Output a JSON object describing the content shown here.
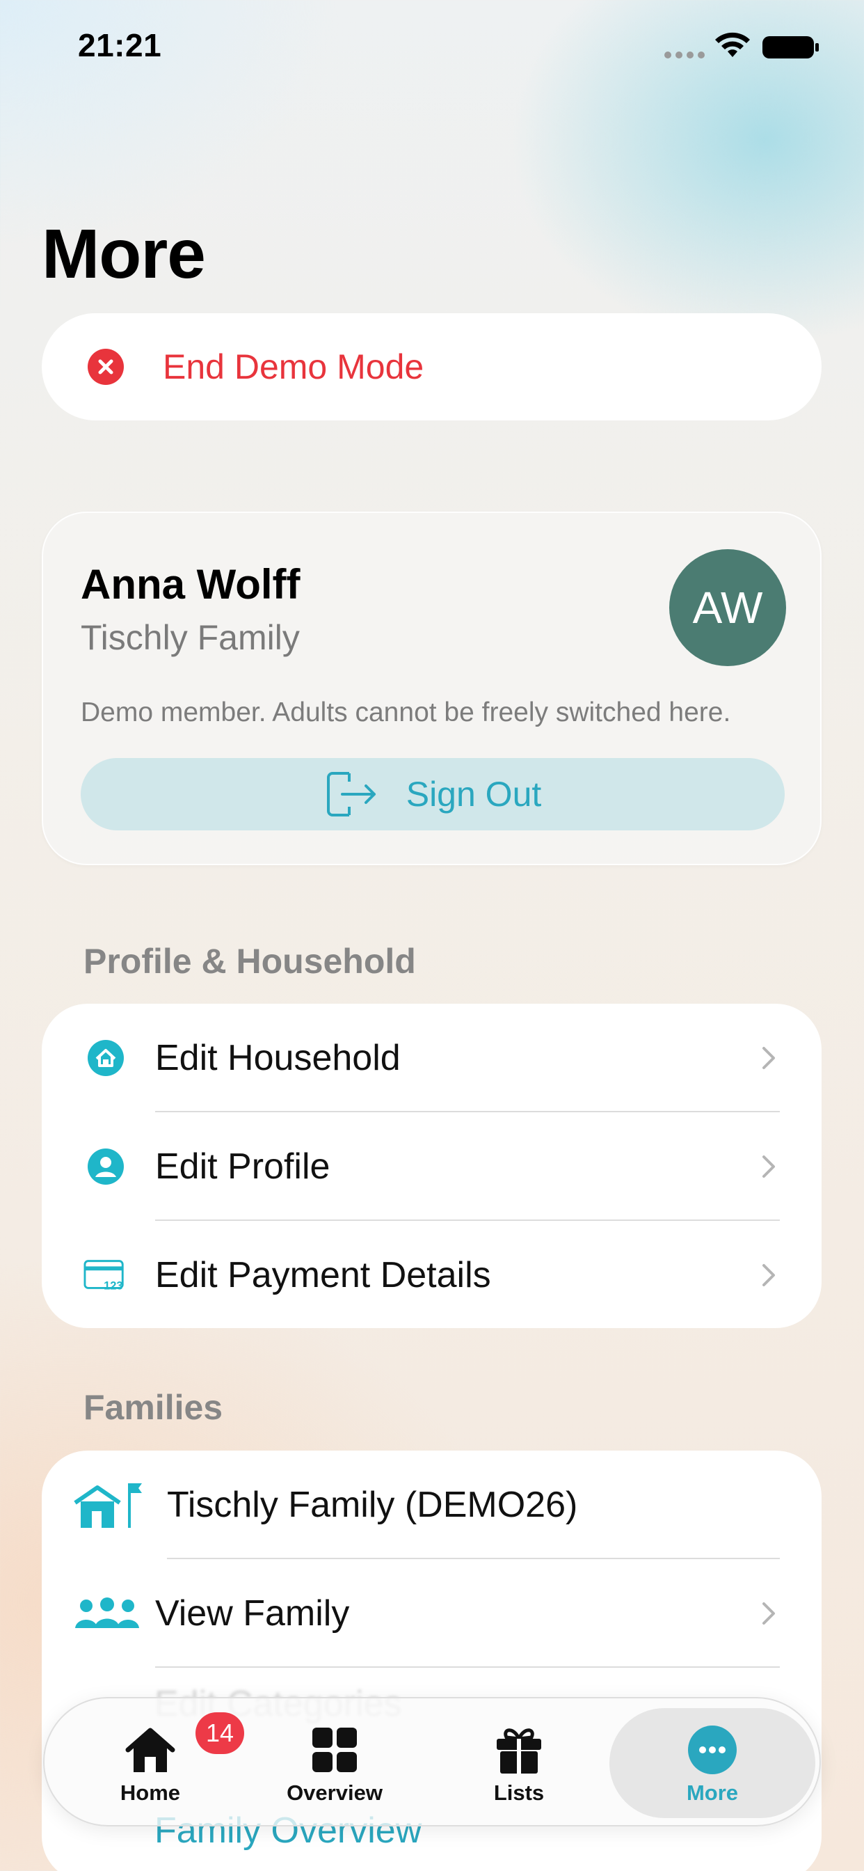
{
  "status_bar": {
    "time": "21:21"
  },
  "title": "More",
  "demo": {
    "label": "End Demo Mode"
  },
  "profile": {
    "name": "Anna Wolff",
    "family": "Tischly Family",
    "initials": "AW",
    "note": "Demo member. Adults cannot be freely switched here.",
    "sign_out_label": "Sign Out"
  },
  "sections": {
    "profile_household": {
      "header": "Profile & Household",
      "items": [
        {
          "label": "Edit Household",
          "icon": "house-circle-icon"
        },
        {
          "label": "Edit Profile",
          "icon": "person-circle-icon"
        },
        {
          "label": "Edit Payment Details",
          "icon": "credit-card-icon"
        }
      ]
    },
    "families": {
      "header": "Families",
      "items": [
        {
          "label": "Tischly Family (DEMO26)",
          "icon": "house-flag-icon"
        },
        {
          "label": "View Family",
          "icon": "people-icon"
        },
        {
          "label": "Edit Categories",
          "icon": "heart-icon"
        },
        {
          "label": "Family Overview",
          "icon": "grid-icon"
        }
      ]
    }
  },
  "tab_bar": {
    "tabs": [
      {
        "label": "Home",
        "icon": "house-icon",
        "badge": "14"
      },
      {
        "label": "Overview",
        "icon": "grid-icon"
      },
      {
        "label": "Lists",
        "icon": "gift-icon"
      },
      {
        "label": "More",
        "icon": "ellipsis-circle-icon",
        "active": true
      }
    ]
  },
  "colors": {
    "accent": "#2aa7bf",
    "destructive": "#e8343c",
    "avatar": "#4b7c72",
    "badge": "#ed3a47"
  }
}
